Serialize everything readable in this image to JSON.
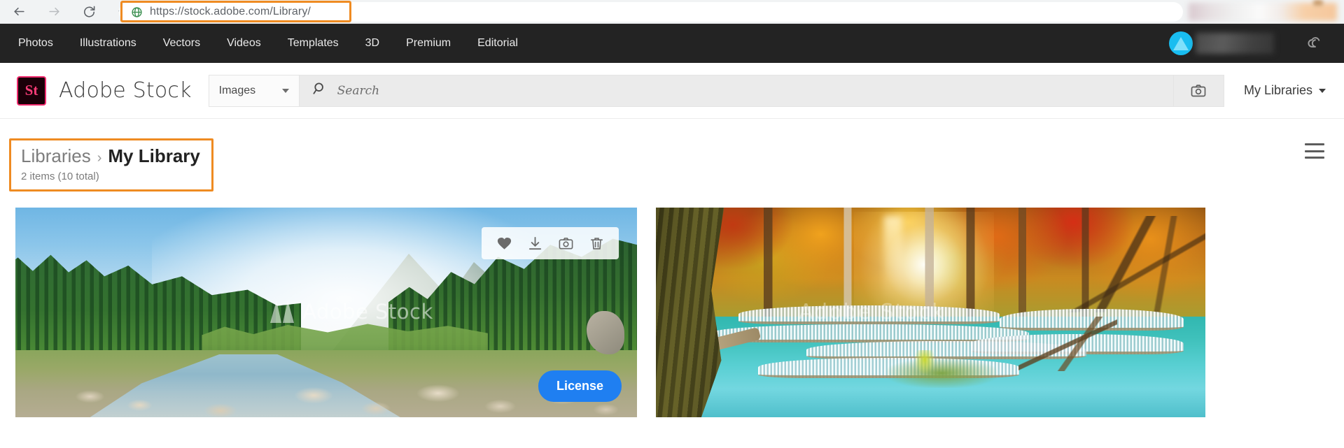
{
  "browser": {
    "back_icon": "back-arrow-icon",
    "forward_icon": "forward-arrow-icon",
    "reload_icon": "reload-icon",
    "home_icon": "home-icon",
    "site_icon": "globe-icon",
    "url": "https://stock.adobe.com/Library/",
    "highlight_color": "#ef8b22"
  },
  "adobe_nav": {
    "items": [
      {
        "label": "Photos"
      },
      {
        "label": "Illustrations"
      },
      {
        "label": "Vectors"
      },
      {
        "label": "Videos"
      },
      {
        "label": "Templates"
      },
      {
        "label": "3D"
      },
      {
        "label": "Premium"
      },
      {
        "label": "Editorial"
      }
    ],
    "avatar_icon": "user-avatar",
    "avatar_color": "#19bdf0",
    "cc_icon": "creative-cloud-icon",
    "background": "#232323"
  },
  "header": {
    "logo_mark": "St",
    "logo_color": "#fa3c78",
    "wordmark": "Adobe Stock",
    "search_type": "Images",
    "search_type_chevron": "chevron-down-icon",
    "search_icon": "search-icon",
    "search_value": "",
    "search_placeholder": "Search",
    "camera_icon": "camera-search-icon",
    "my_libraries": "My Libraries",
    "my_libraries_chevron": "chevron-down-icon"
  },
  "breadcrumb": {
    "root": "Libraries",
    "separator": "›",
    "current": "My Library",
    "count": "2 items (10 total)",
    "highlight_color": "#ef8b22"
  },
  "toolbar": {
    "menu_icon": "hamburger-menu-icon"
  },
  "assets": [
    {
      "name": "mountain-river-forest",
      "watermark": "Adobe Stock",
      "watermark_mark": "adobe-a-logo",
      "tools": [
        {
          "icon": "heart-icon",
          "name": "favorite-button"
        },
        {
          "icon": "download-icon",
          "name": "download-button"
        },
        {
          "icon": "camera-icon",
          "name": "visual-search-button"
        },
        {
          "icon": "trash-icon",
          "name": "delete-button"
        }
      ],
      "license_label": "License",
      "license_color": "#1f7ff1"
    },
    {
      "name": "autumn-waterfall-turquoise",
      "watermark": "Adobe Stock"
    }
  ]
}
